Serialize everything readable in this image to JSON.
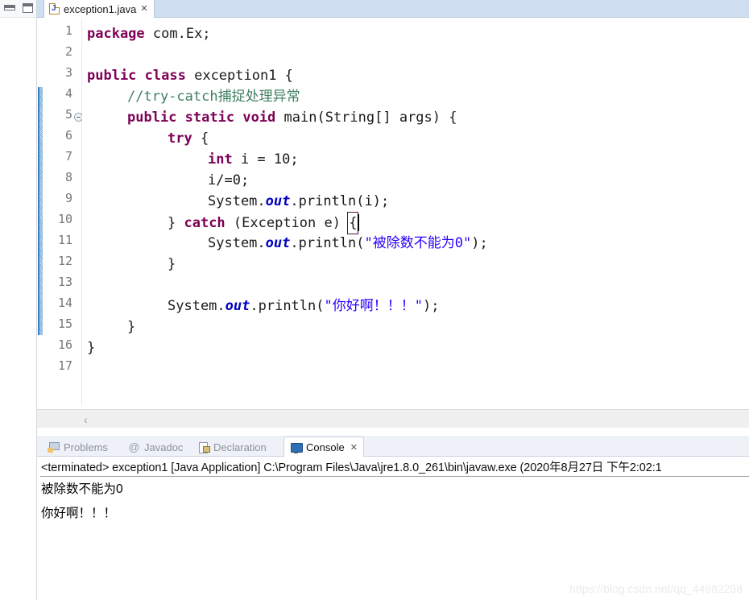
{
  "window": {
    "rail": {
      "minimize_icon": "minimize-view-icon",
      "maximize_icon": "maximize-view-icon"
    }
  },
  "editor": {
    "tab": {
      "icon": "java-file-icon",
      "label": "exception1.java",
      "close": "✕"
    },
    "scroll_left_arrow": "‹",
    "lines": [
      {
        "num": "1",
        "fold": false,
        "text": "package com.Ex;"
      },
      {
        "num": "2",
        "fold": false,
        "text": ""
      },
      {
        "num": "3",
        "fold": false,
        "text": "public class exception1 {"
      },
      {
        "num": "4",
        "fold": false,
        "text": "    //try-catch捕捉处理异常"
      },
      {
        "num": "5",
        "fold": true,
        "text": "    public static void main(String[] args) {"
      },
      {
        "num": "6",
        "fold": false,
        "text": "        try {"
      },
      {
        "num": "7",
        "fold": false,
        "text": "            int i = 10;"
      },
      {
        "num": "8",
        "fold": false,
        "text": "            i/=0;"
      },
      {
        "num": "9",
        "fold": false,
        "text": "            System.out.println(i);"
      },
      {
        "num": "10",
        "fold": false,
        "text": "        } catch (Exception e) {"
      },
      {
        "num": "11",
        "fold": false,
        "text": "            System.out.println(\"被除数不能为0\");"
      },
      {
        "num": "12",
        "fold": false,
        "text": "        }"
      },
      {
        "num": "13",
        "fold": false,
        "text": ""
      },
      {
        "num": "14",
        "fold": false,
        "text": "        System.out.println(\"你好啊！！！\");"
      },
      {
        "num": "15",
        "fold": false,
        "text": "    }"
      },
      {
        "num": "16",
        "fold": false,
        "text": "}"
      },
      {
        "num": "17",
        "fold": false,
        "text": ""
      }
    ],
    "current_line": "12",
    "tokens": {
      "package": "package",
      "com_ex": " com.Ex;",
      "public": "public",
      "class": "class",
      "exception1_decl": " exception1 {",
      "comment": "//try-catch捕捉处理异常",
      "static": "static",
      "void": "void",
      "main_sig": " main(String[] args) {",
      "try": "try",
      "brace_open": " {",
      "int": "int",
      "i_assign": " i = 10;",
      "i_div": "i/=0;",
      "system": "System.",
      "out": "out",
      "println_i": ".println(i);",
      "catch_pre": "} ",
      "catch": "catch",
      "catch_sig": " (Exception e) ",
      "catch_brace": "{",
      "println_open": ".println(",
      "str_div": "\"被除数不能为0\"",
      "str_hello": "\"你好啊！！！\"",
      "println_close": ");",
      "close_brace": "}"
    },
    "colors": {
      "keyword": "#7f0055",
      "comment": "#3f7f5f",
      "string": "#2a00ff",
      "field": "#0000c0",
      "text": "#1a1a1a",
      "current_line_bg": "#e4eefb",
      "tabbar_bg": "#cfdef0"
    }
  },
  "bottom_panel": {
    "tabs": [
      {
        "label": "Problems",
        "icon": "problems-icon",
        "active": false,
        "closable": false
      },
      {
        "label": "Javadoc",
        "icon": "javadoc-icon",
        "active": false,
        "closable": false
      },
      {
        "label": "Declaration",
        "icon": "declaration-icon",
        "active": false,
        "closable": false
      },
      {
        "label": "Console",
        "icon": "console-icon",
        "active": true,
        "closable": true
      }
    ],
    "close_glyph": "✕",
    "javadoc_glyph": "@",
    "console": {
      "terminated_line": "<terminated> exception1 [Java Application] C:\\Program Files\\Java\\jre1.8.0_261\\bin\\javaw.exe (2020年8月27日 下午2:02:1",
      "output": [
        "被除数不能为0",
        "你好啊！！！"
      ]
    }
  },
  "watermark": "https://blog.csdn.net/qq_44982298"
}
